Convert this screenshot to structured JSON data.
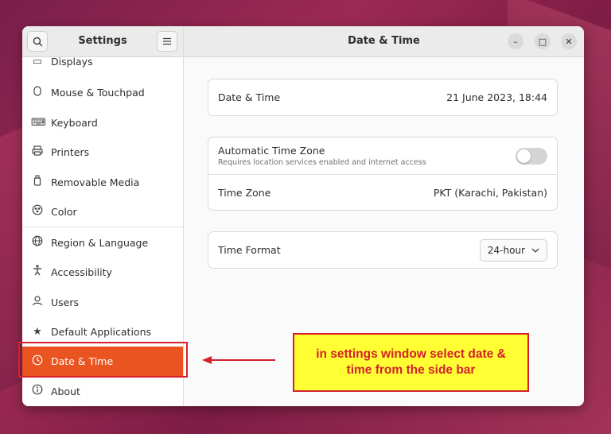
{
  "sidebar": {
    "title": "Settings",
    "search_icon": "search-icon",
    "menu_icon": "hamburger-menu-icon",
    "items": [
      {
        "label": "Displays",
        "icon": "display-icon"
      },
      {
        "label": "Mouse & Touchpad",
        "icon": "mouse-icon"
      },
      {
        "label": "Keyboard",
        "icon": "keyboard-icon"
      },
      {
        "label": "Printers",
        "icon": "printer-icon"
      },
      {
        "label": "Removable Media",
        "icon": "usb-drive-icon"
      },
      {
        "label": "Color",
        "icon": "color-palette-icon"
      },
      {
        "label": "Region & Language",
        "icon": "globe-icon"
      },
      {
        "label": "Accessibility",
        "icon": "accessibility-icon"
      },
      {
        "label": "Users",
        "icon": "users-icon"
      },
      {
        "label": "Default Applications",
        "icon": "star-icon"
      },
      {
        "label": "Date & Time",
        "icon": "clock-icon",
        "selected": true
      },
      {
        "label": "About",
        "icon": "info-icon"
      }
    ]
  },
  "header": {
    "title": "Date & Time",
    "minimize_label": "–",
    "maximize_label": "□",
    "close_label": "✕"
  },
  "date_time": {
    "label": "Date & Time",
    "value": "21 June 2023, 18:44"
  },
  "timezone": {
    "auto_label": "Automatic Time Zone",
    "auto_subtitle": "Requires location services enabled and internet access",
    "auto_enabled": false,
    "tz_label": "Time Zone",
    "tz_value": "PKT (Karachi, Pakistan)"
  },
  "time_format": {
    "label": "Time Format",
    "value": "24-hour"
  },
  "annotation": {
    "text": "in settings window select date & time from the side bar"
  },
  "colors": {
    "accent": "#e95420",
    "annotation_border": "#d4212b",
    "annotation_bg": "#ffff33"
  }
}
